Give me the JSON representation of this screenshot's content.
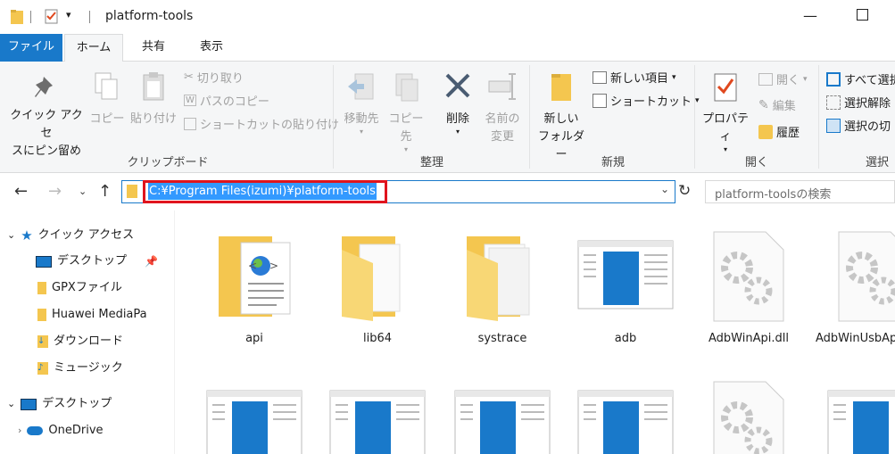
{
  "titlebar": {
    "title": "platform-tools"
  },
  "tabs": {
    "file": "ファイル",
    "home": "ホーム",
    "share": "共有",
    "view": "表示"
  },
  "ribbon": {
    "clipboard": {
      "label": "クリップボード",
      "pin": "クイック アクセ\nスにピン留め",
      "copy": "コピー",
      "paste": "貼り付け",
      "cut": "切り取り",
      "copy_path": "パスのコピー",
      "paste_shortcut": "ショートカットの貼り付け"
    },
    "organize": {
      "label": "整理",
      "move_to": "移動先",
      "copy_to": "コピー先",
      "delete": "削除",
      "rename": "名前の\n変更"
    },
    "new": {
      "label": "新規",
      "new_folder": "新しい\nフォルダー",
      "new_item": "新しい項目",
      "shortcut": "ショートカット"
    },
    "open": {
      "label": "開く",
      "properties": "プロパティ",
      "open": "開く",
      "edit": "編集",
      "history": "履歴"
    },
    "select": {
      "label": "選択",
      "select_all": "すべて選択",
      "select_none": "選択解除",
      "invert": "選択の切"
    }
  },
  "nav": {
    "address": "C:¥Program Files(izumi)¥platform-tools",
    "search_placeholder": "platform-toolsの検索"
  },
  "sidebar": {
    "items": [
      {
        "label": "クイック アクセス"
      },
      {
        "label": "デスクトップ"
      },
      {
        "label": "GPXファイル"
      },
      {
        "label": "Huawei MediaPa"
      },
      {
        "label": "ダウンロード"
      },
      {
        "label": "ミュージック"
      },
      {
        "label": "デスクトップ"
      },
      {
        "label": "OneDrive"
      }
    ]
  },
  "files": [
    {
      "name": "api",
      "icon": "html-folder-icon"
    },
    {
      "name": "lib64",
      "icon": "folder-icon"
    },
    {
      "name": "systrace",
      "icon": "folder-icon"
    },
    {
      "name": "adb",
      "icon": "app-window-icon"
    },
    {
      "name": "AdbWinApi.dll",
      "icon": "dll-gear-icon"
    },
    {
      "name": "AdbWinUsbApi.dll",
      "icon": "dll-gear-icon"
    }
  ],
  "colors": {
    "accent": "#1979ca",
    "highlight_border": "#e0141e",
    "selection": "#3399ff",
    "folder": "#f4c64f"
  }
}
